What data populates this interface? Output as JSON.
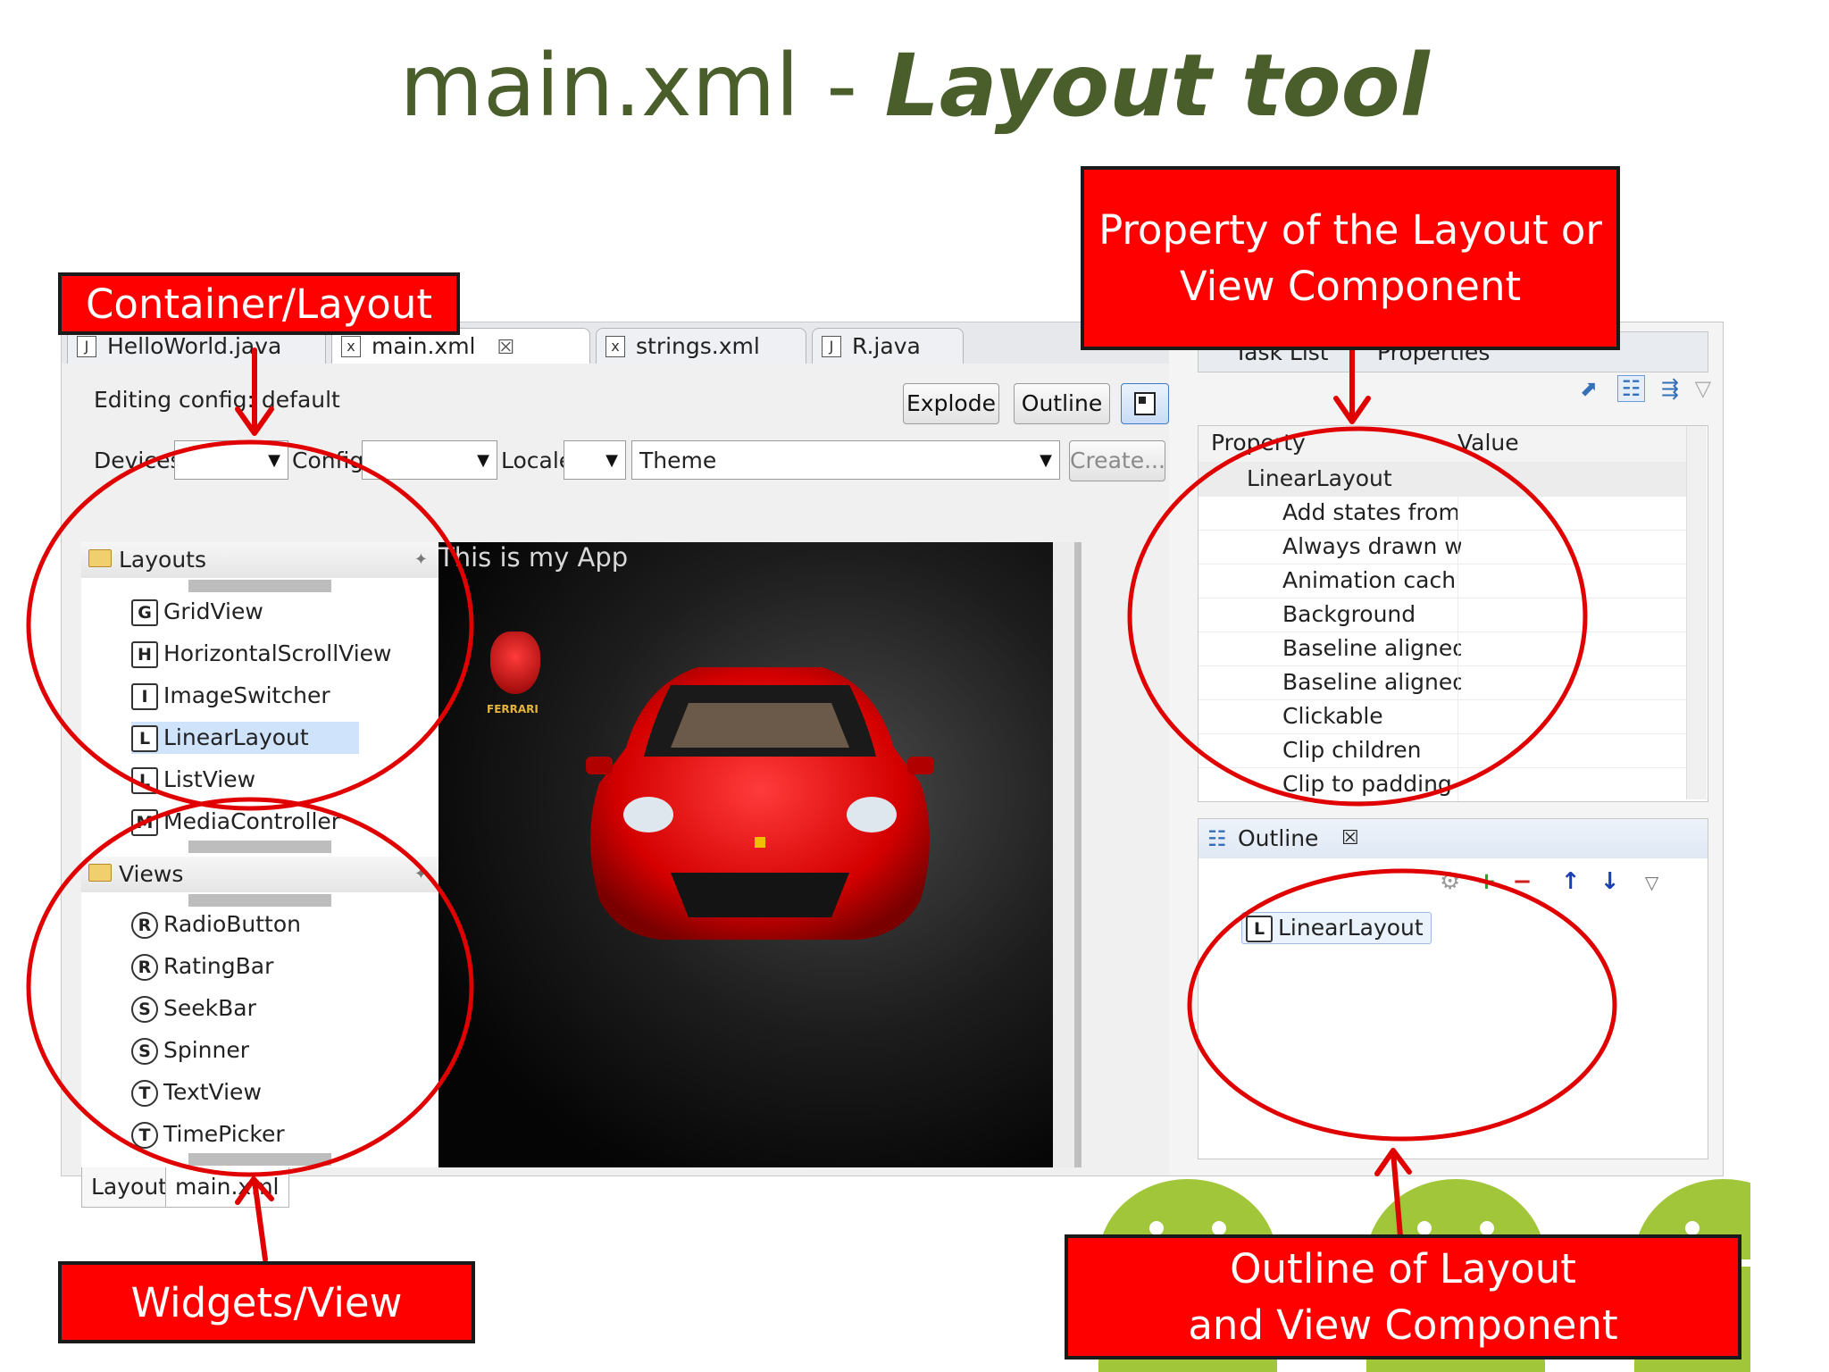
{
  "slide": {
    "title_plain": "main.xml - ",
    "title_emph": "Layout tool"
  },
  "editor_tabs": [
    {
      "label": "HelloWorld.java",
      "icon": "J"
    },
    {
      "label": "main.xml",
      "icon": "x",
      "close": "☒"
    },
    {
      "label": "strings.xml",
      "icon": "x"
    },
    {
      "label": "R.java",
      "icon": "J"
    }
  ],
  "toolbar": {
    "editing_config": "Editing config: default",
    "explode": "Explode",
    "outline": "Outline",
    "devices_label": "Devices",
    "config_label": "Config",
    "locale_label": "Locale",
    "theme_value": "Theme",
    "create_label": "Create..."
  },
  "palette": {
    "layouts_header": "Layouts",
    "layouts": [
      {
        "icon": "G",
        "label": "GridView"
      },
      {
        "icon": "H",
        "label": "HorizontalScrollView"
      },
      {
        "icon": "I",
        "label": "ImageSwitcher"
      },
      {
        "icon": "L",
        "label": "LinearLayout",
        "selected": true
      },
      {
        "icon": "L",
        "label": "ListView"
      },
      {
        "icon": "M",
        "label": "MediaController"
      }
    ],
    "views_header": "Views",
    "views": [
      {
        "icon": "R",
        "label": "RadioButton"
      },
      {
        "icon": "R",
        "label": "RatingBar"
      },
      {
        "icon": "S",
        "label": "SeekBar"
      },
      {
        "icon": "S",
        "label": "Spinner"
      },
      {
        "icon": "T",
        "label": "TextView"
      },
      {
        "icon": "T",
        "label": "TimePicker"
      }
    ]
  },
  "canvas": {
    "app_title": "This is my App",
    "logo_text": "FERRARI"
  },
  "bottom_tabs": [
    "Layout",
    "main.xml"
  ],
  "properties_panel": {
    "tabs": [
      "Task List",
      "Properties"
    ],
    "col_property": "Property",
    "col_value": "Value",
    "group": "LinearLayout",
    "rows": [
      "Add states from",
      "Always drawn w",
      "Animation cach",
      "Background",
      "Baseline aligned",
      "Baseline aligned",
      "Clickable",
      "Clip children",
      "Clip to padding"
    ]
  },
  "outline_panel": {
    "title": "Outline",
    "node_icon": "L",
    "node": "LinearLayout"
  },
  "annotations": {
    "container_layout": "Container/Layout",
    "property_line1": "Property of the Layout or",
    "property_line2": "View Component",
    "widgets_view": "Widgets/View",
    "outline_line1": "Outline of Layout",
    "outline_line2": "and View Component"
  },
  "colors": {
    "title_green": "#4a5e2b",
    "callout_red": "#ff0000",
    "ellipse_red": "#e10000",
    "android_green": "#97c024"
  }
}
